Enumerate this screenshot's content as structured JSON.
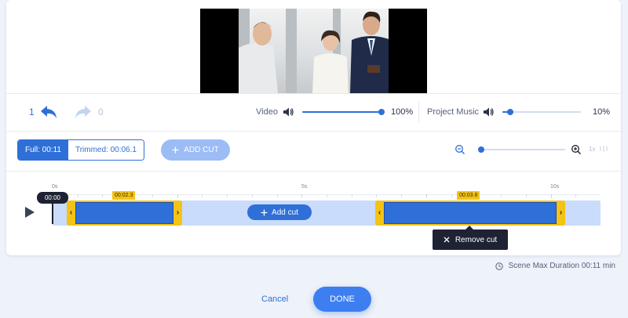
{
  "history": {
    "undo_count": "1",
    "redo_count": "0",
    "undo_icon": "undo-arrow-icon",
    "redo_icon": "redo-arrow-icon"
  },
  "audio": {
    "video_label": "Video",
    "video_volume_label": "100%",
    "video_volume": 1.0,
    "music_label": "Project Music",
    "music_volume_label": "10%",
    "music_volume": 0.1,
    "speaker_icon": "speaker-icon"
  },
  "trim_mode": {
    "full_label": "Full: 00:11",
    "trimmed_label": "Trimmed: 00:06.1",
    "selected": "full"
  },
  "add_cut_top": {
    "label": "ADD CUT",
    "icon": "plus-icon",
    "enabled": false
  },
  "zoom": {
    "level_label": "1x",
    "value": 0.0,
    "zoom_out_icon": "zoom-out-icon",
    "zoom_in_icon": "zoom-in-icon"
  },
  "timeline": {
    "ruler_labels": [
      "0s",
      "5s",
      "10s"
    ],
    "playhead_time": "00:00",
    "clips": [
      {
        "start_badge": "00:02.3"
      },
      {
        "start_badge": "00:03.8"
      }
    ],
    "add_cut_label": "Add cut",
    "remove_cut_label": "Remove cut"
  },
  "footer": {
    "max_duration_label": "Scene Max Duration 00:11 min",
    "cancel_label": "Cancel",
    "done_label": "DONE"
  },
  "colors": {
    "accent": "#2f6fd8",
    "clip_frame": "#f4c313",
    "track": "#c9dcfb",
    "dark": "#1e2233"
  }
}
